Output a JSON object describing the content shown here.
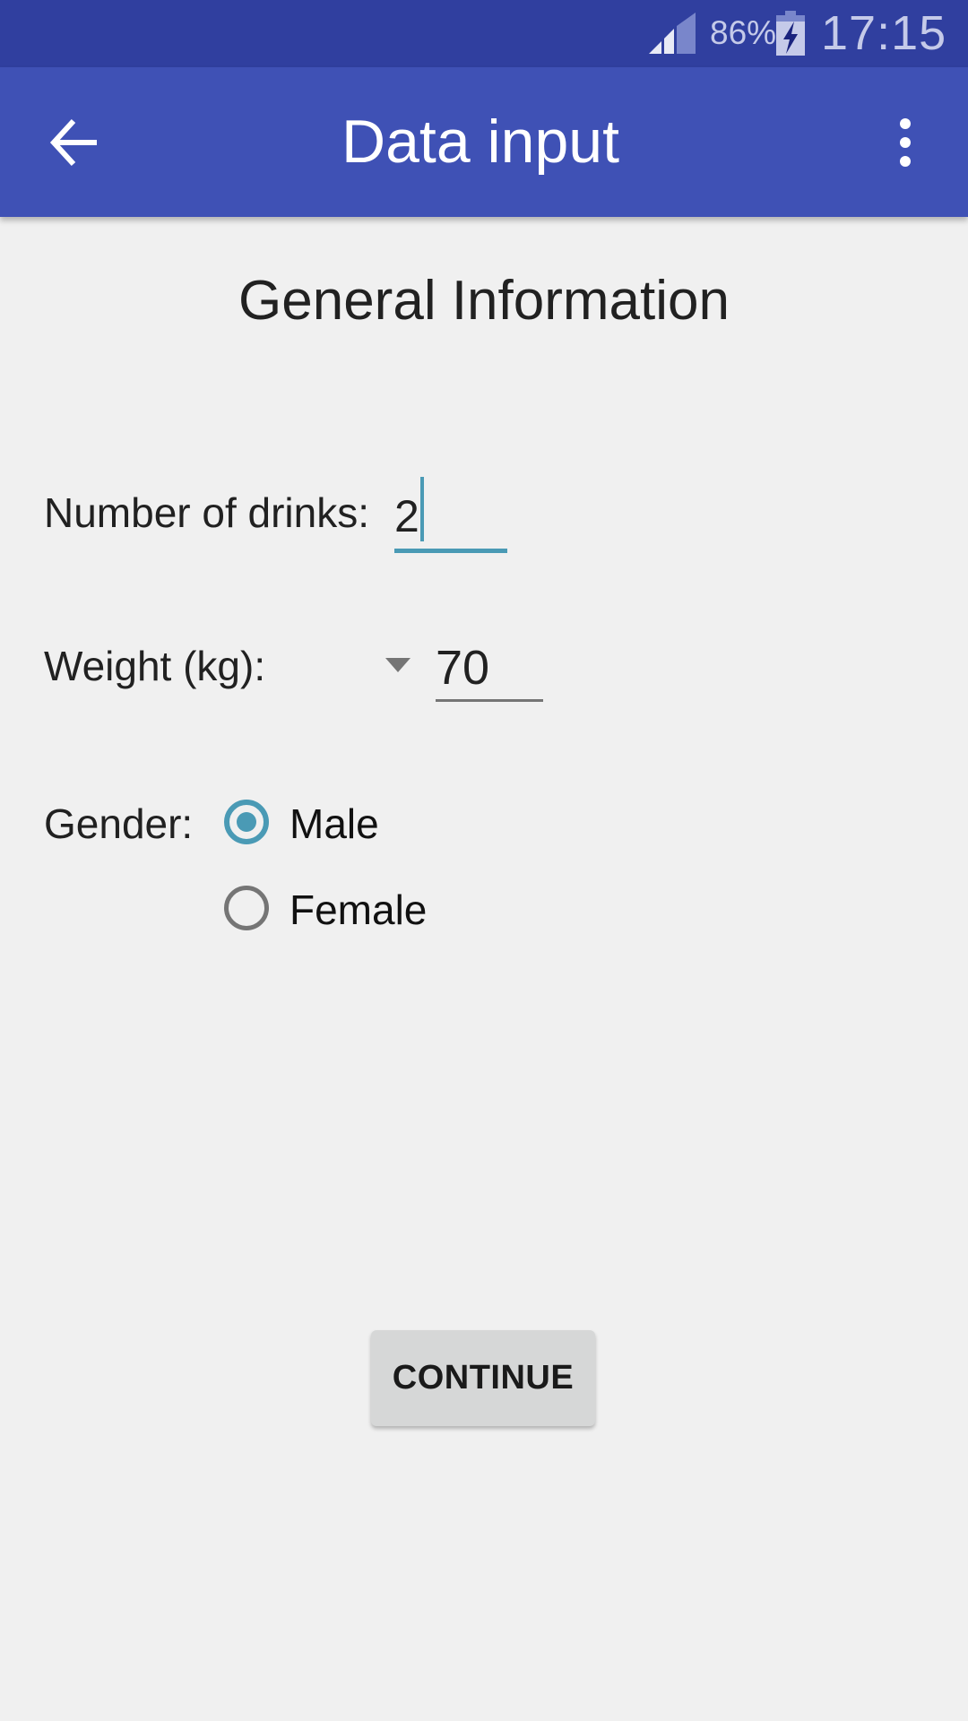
{
  "status_bar": {
    "signal_icon": "cell-signal-icon",
    "battery_percent": "86%",
    "battery_icon": "battery-charging-icon",
    "time": "17:15"
  },
  "app_bar": {
    "back_icon": "arrow-back-icon",
    "title": "Data input",
    "more_icon": "more-vert-icon",
    "background_color": "#3f51b5"
  },
  "form": {
    "section_title": "General Information",
    "drinks": {
      "label": "Number of drinks:",
      "value": "2"
    },
    "weight": {
      "label": "Weight (kg):",
      "value": "70"
    },
    "gender": {
      "label": "Gender:",
      "options": [
        {
          "label": "Male",
          "checked": true
        },
        {
          "label": "Female",
          "checked": false
        }
      ]
    },
    "accent_color": "#4a9ab5"
  },
  "continue_button": {
    "label": "CONTINUE"
  }
}
